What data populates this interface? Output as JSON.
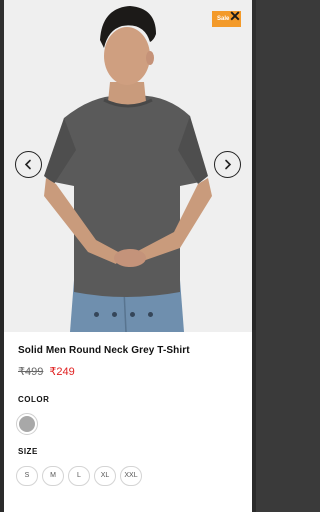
{
  "badge": {
    "sale_label": "Sale"
  },
  "product": {
    "title": "Solid Men Round Neck Grey T-Shirt",
    "mrp": "₹499",
    "price": "₹249"
  },
  "color": {
    "label": "COLOR",
    "swatches": [
      "#a8a8a8"
    ]
  },
  "size": {
    "label": "SIZE",
    "options": [
      "S",
      "M",
      "L",
      "XL",
      "XXL"
    ]
  },
  "gallery": {
    "dots": 4
  },
  "colors": {
    "accent_sale": "#f39a2a",
    "price_red": "#e02020"
  }
}
